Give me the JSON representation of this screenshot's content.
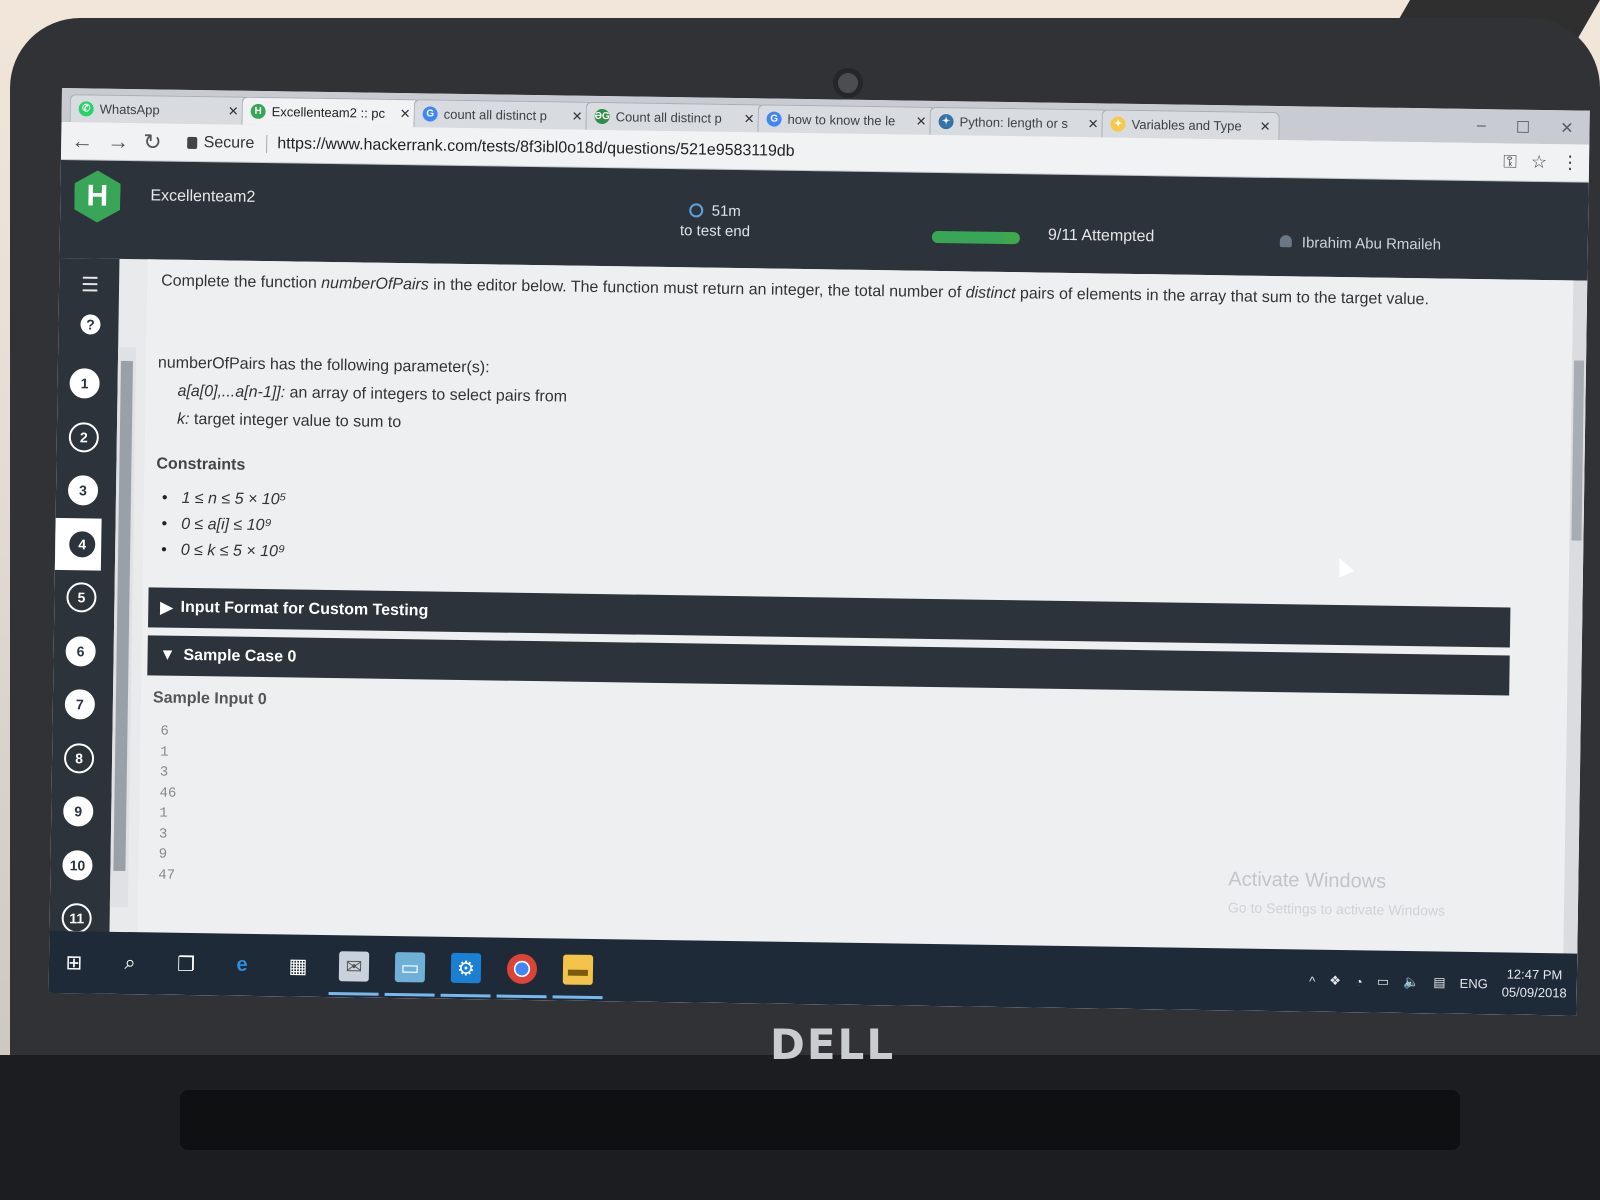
{
  "browser": {
    "tabs": [
      {
        "label": "WhatsApp",
        "icon": "whatsapp-icon",
        "color": "#25d366",
        "glyph": "✆"
      },
      {
        "label": "Excellenteam2 :: pc",
        "icon": "hackerrank-icon",
        "color": "#38a656",
        "glyph": "H"
      },
      {
        "label": "count all distinct p",
        "icon": "google-icon",
        "color": "#4285f4",
        "glyph": "G"
      },
      {
        "label": "Count all distinct p",
        "icon": "geeksforgeeks-icon",
        "color": "#2f8d46",
        "glyph": "ƏG"
      },
      {
        "label": "how to know the le",
        "icon": "google-icon",
        "color": "#4285f4",
        "glyph": "G"
      },
      {
        "label": "Python: length or s",
        "icon": "python-icon",
        "color": "#3572a5",
        "glyph": "✦"
      },
      {
        "label": "Variables and Type",
        "icon": "python-icon",
        "color": "#f7c948",
        "glyph": "✦"
      }
    ],
    "secure_label": "Secure",
    "url": "https://www.hackerrank.com/tests/8f3ibl0o18d/questions/521e9583119db"
  },
  "header": {
    "org": "Excellenteam2",
    "logo": "H",
    "timer_value": "51m",
    "timer_caption": "to test end",
    "progress_fraction": 0.82,
    "attempted": "9/11 Attempted",
    "user": "Ibrahim Abu Rmaileh",
    "accent": "#38a656"
  },
  "sidebar": {
    "questions": [
      "1",
      "2",
      "3",
      "4",
      "5",
      "6",
      "7",
      "8",
      "9",
      "10",
      "11"
    ],
    "current": "4"
  },
  "problem": {
    "intro_1": "Complete the function ",
    "func_name": "numberOfPairs",
    "intro_2": " in the editor below. The function must return an integer, the total number of ",
    "intro_em": "distinct",
    "intro_3": " pairs of elements in the array that sum to the target value.",
    "params_heading": "numberOfPairs has the following parameter(s):",
    "param_a_name": "a[a[0],...a[n-1]]:",
    "param_a_desc": " an array of integers to select pairs from",
    "param_k_name": "k:",
    "param_k_desc": " target integer value to sum to",
    "constraints_heading": "Constraints",
    "constraints": [
      "1 ≤ n ≤ 5 × 10⁵",
      "0 ≤ a[i] ≤ 10⁹",
      "0 ≤ k ≤ 5 × 10⁹"
    ],
    "section_input_format": "Input Format for Custom Testing",
    "section_sample_case": "Sample Case 0",
    "sample_input_heading": "Sample Input 0",
    "sample_input": [
      "6",
      "1",
      "3",
      "46",
      "1",
      "3",
      "9",
      "47"
    ]
  },
  "watermark": {
    "title": "Activate Windows",
    "subtitle": "Go to Settings to activate Windows"
  },
  "taskbar": {
    "lang": "ENG",
    "time": "12:47 PM",
    "date": "05/09/2018"
  },
  "laptop_brand": "DELL"
}
